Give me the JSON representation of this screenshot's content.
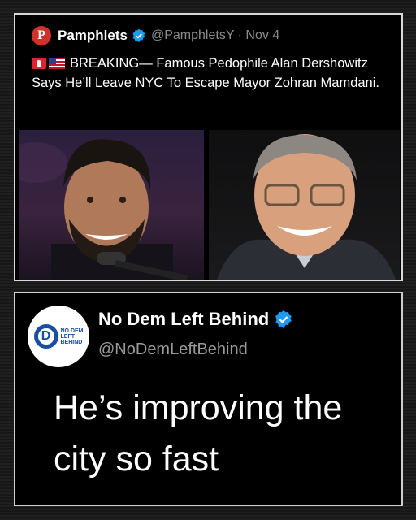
{
  "top_tweet": {
    "avatar_letter": "P",
    "display_name": "Pamphlets",
    "meta": "@PamphletsY · Nov 4",
    "text": "BREAKING—  Famous Pedophile Alan Dershowitz Says He’ll Leave NYC To Escape Mayor Zohran Mamdani.",
    "icons": [
      "siren-emoji",
      "us-flag-emoji",
      "verified-badge"
    ]
  },
  "bottom_tweet": {
    "avatar_letter": "D",
    "avatar_text_lines": [
      "NO DEM",
      "LEFT",
      "BEHIND"
    ],
    "display_name": "No Dem Left Behind",
    "handle": "@NoDemLeftBehind",
    "text": "He’s improving the city so fast"
  },
  "colors": {
    "verified": "#1d9bf0",
    "pamphlets_red": "#d0322b",
    "ndlb_blue": "#1a4fa0"
  }
}
